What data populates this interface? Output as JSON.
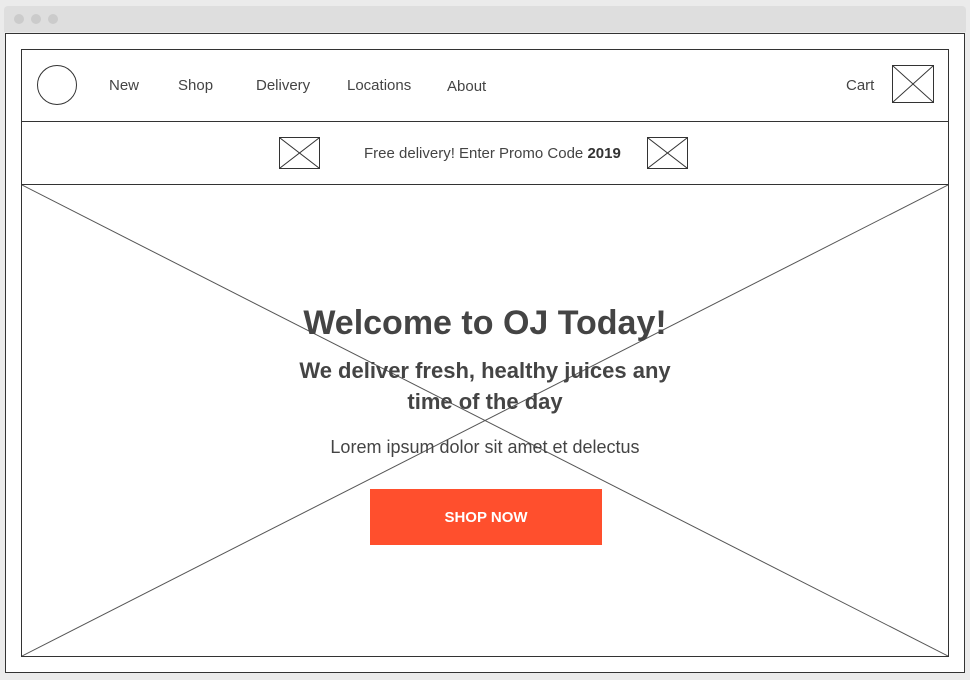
{
  "nav": {
    "links": [
      "New",
      "Shop",
      "Delivery",
      "Locations",
      "About"
    ],
    "cart_label": "Cart"
  },
  "promo": {
    "text": "Free delivery! Enter Promo Code",
    "code": "2019"
  },
  "hero": {
    "title": "Welcome to OJ Today!",
    "subtitle": "We deliver fresh, healthy juices any time of the day",
    "body": "Lorem ipsum dolor sit amet et delectus",
    "cta_label": "SHOP NOW"
  },
  "colors": {
    "accent": "#ff4f2d",
    "text": "#444444",
    "wireframe_line": "#333333"
  },
  "icons": {
    "logo": "circle-logo-placeholder",
    "cart": "image-placeholder",
    "promo_left": "image-placeholder",
    "promo_right": "image-placeholder",
    "hero_bg": "image-placeholder"
  }
}
